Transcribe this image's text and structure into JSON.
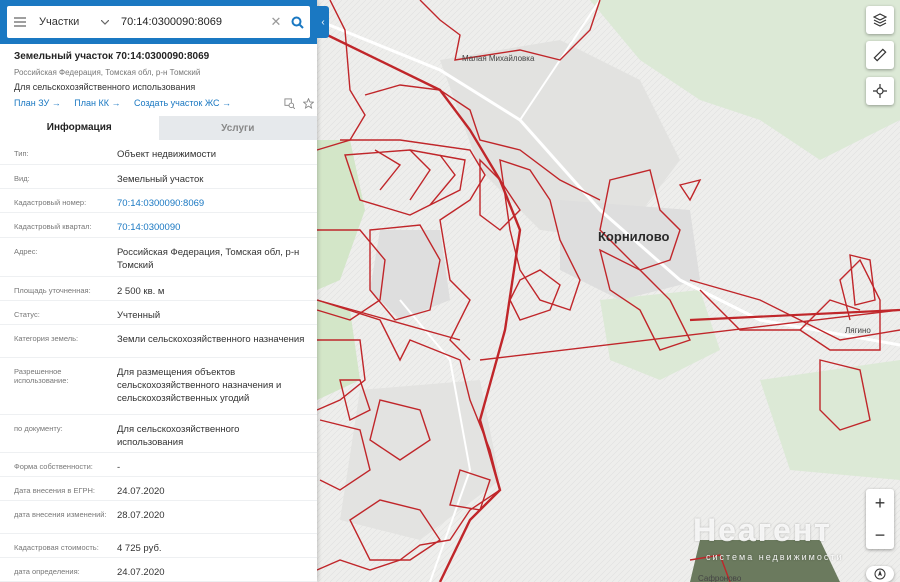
{
  "search": {
    "type_label": "Участки",
    "query": "70:14:0300090:8069"
  },
  "object": {
    "title": "Земельный участок 70:14:0300090:8069",
    "address": "Российская Федерация, Томская обл, р-н Томский",
    "use": "Для сельскохозяйственного использования",
    "links": [
      "План ЗУ →",
      "План КК →",
      "Создать участок ЖС →"
    ]
  },
  "tabs": [
    "Информация",
    "Услуги"
  ],
  "info": [
    {
      "key": "Тип:",
      "value": "Объект недвижимости"
    },
    {
      "key": "Вид:",
      "value": "Земельный участок"
    },
    {
      "key": "Кадастровый номер:",
      "value": "70:14:0300090:8069",
      "link": true
    },
    {
      "key": "Кадастровый квартал:",
      "value": "70:14:0300090",
      "link": true
    },
    {
      "key": "Адрес:",
      "value": "Российская Федерация, Томская обл, р-н Томский"
    },
    {
      "key": "Площадь уточненная:",
      "value": "2 500 кв. м"
    },
    {
      "key": "Статус:",
      "value": "Учтенный"
    },
    {
      "key": "Категория земель:",
      "value": "Земли сельскохозяйственного назначения"
    },
    {
      "key": "Разрешенное использование:",
      "value": "Для размещения объектов сельскохозяйственного назначения и сельскохозяйственных угодий"
    },
    {
      "key": "по документу:",
      "value": "Для сельскохозяйственного использования"
    },
    {
      "key": "Форма собственности:",
      "value": "-"
    },
    {
      "key": "Дата внесения в ЕГРН:",
      "value": "24.07.2020"
    },
    {
      "key": "дата внесения изменений:",
      "value": "28.07.2020"
    },
    {
      "key": "Кадастровая стоимость:",
      "value": "4 725 руб."
    },
    {
      "key": "дата определения:",
      "value": "24.07.2020"
    }
  ],
  "map": {
    "labels": {
      "malaya_mikhailovka": "Малая Михайловка",
      "kornilovo": "Корнилово",
      "lyagino": "Лягино",
      "safronovo": "Сафроново"
    },
    "watermark": "Неагент",
    "watermark_sub": "система недвижимости",
    "parcel_color": "#c0262a",
    "accent": "#1a78c2"
  }
}
